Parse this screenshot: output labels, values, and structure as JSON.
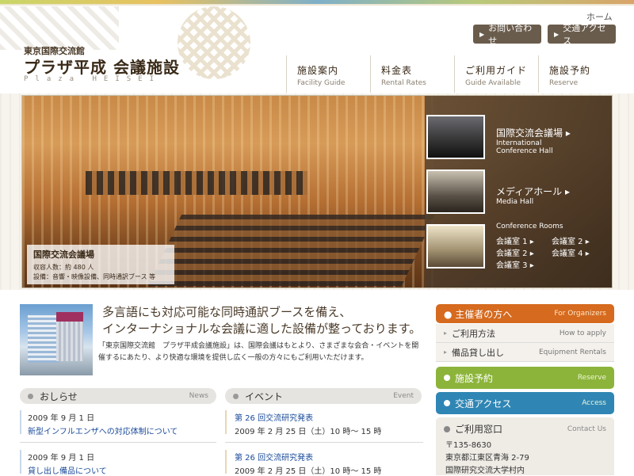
{
  "site": {
    "org": "東京国際交流館",
    "title": "プラザ平成  会議施設",
    "roman": "Plaza HEISEI"
  },
  "utility": {
    "home": "ホーム",
    "contact": "お問い合わせ",
    "access": "交通アクセス"
  },
  "nav": [
    {
      "jp": "施設案内",
      "en": "Facility Guide"
    },
    {
      "jp": "料金表",
      "en": "Rental Rates"
    },
    {
      "jp": "ご利用ガイド",
      "en": "Guide Available"
    },
    {
      "jp": "施設予約",
      "en": "Reserve"
    }
  ],
  "hero": {
    "caption_title": "国際交流会議場",
    "caption_capacity": "収容人数：約 480 人",
    "caption_equipment": "設備：音響・映像設備、同時通訳ブース 等",
    "halls": [
      {
        "jp": "国際交流会議場 ▸",
        "en1": "International",
        "en2": "Conference Hall"
      },
      {
        "jp": "メディアホール ▸",
        "en1": "Media Hall"
      }
    ],
    "conference_heading": "Conference Rooms",
    "rooms": [
      "会議室 1 ▸",
      "会議室 2 ▸",
      "会議室 2 ▸",
      "会議室 4 ▸",
      "会議室 3 ▸"
    ]
  },
  "intro": {
    "heading_line1": "多言語にも対応可能な同時通訳ブースを備え、",
    "heading_line2": "インターナショナルな会議に適した設備が整っております。",
    "body": "「東京国際交流館　プラザ平成会議施設」は、国際会議はもとより、さまざまな会合・イベントを開催するにあたり、より快適な環境を提供し広く一般の方々にもご利用いただけます。"
  },
  "news": {
    "heading_jp": "おしらせ",
    "heading_en": "News",
    "items": [
      {
        "date": "2009 年 9 月 1 日",
        "text": "新型インフルエンザへの対応体制について"
      },
      {
        "date": "2009 年 9 月 1 日",
        "text": "貸し出し備品について"
      }
    ]
  },
  "events": {
    "heading_jp": "イベント",
    "heading_en": "Event",
    "items": [
      {
        "title": "第 26 回交流研究発表",
        "date": "2009 年 2 月 25 日（土）10 時〜 15 時"
      },
      {
        "title": "第 26 回交流研究発表",
        "date": "2009 年 2 月 25 日（土）10 時〜 15 時"
      }
    ]
  },
  "sidebar": {
    "organizers_jp": "主催者の方へ",
    "organizers_en": "For Organizers",
    "usage_jp": "ご利用方法",
    "usage_en": "How to apply",
    "rental_jp": "備品貸し出し",
    "rental_en": "Equipment Rentals",
    "reserve_jp": "施設予約",
    "reserve_en": "Reserve",
    "access_jp": "交通アクセス",
    "access_en": "Access",
    "window_jp": "ご利用窓口",
    "window_en": "Contact Us",
    "postal": "〒135-8630",
    "address": "東京都江東区青海 2-79",
    "building": "国際研究交流大学村内"
  },
  "colors": {
    "orange": "#d66a1e",
    "green": "#8cb43a",
    "blue": "#2f86b4",
    "brown": "#6a5c4c"
  }
}
